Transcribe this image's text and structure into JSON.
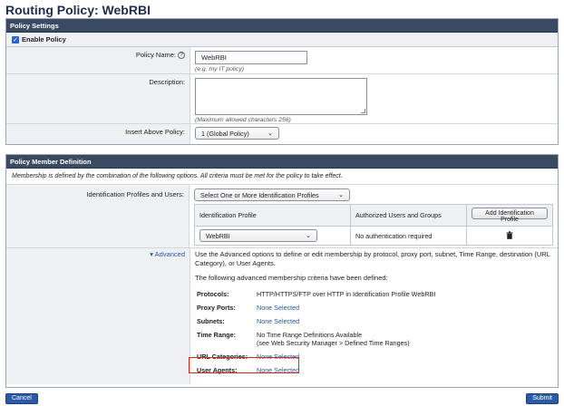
{
  "page": {
    "title": "Routing Policy: WebRBI"
  },
  "policy_settings": {
    "header": "Policy Settings",
    "enable_label": "Enable Policy",
    "name_label": "Policy Name:",
    "name_value": "WebRBI",
    "name_hint": "(e.g. my IT policy)",
    "description_label": "Description:",
    "description_value": "",
    "description_hint": "(Maximum allowed characters 256)",
    "insert_above_label": "Insert Above Policy:",
    "insert_above_value": "1 (Global Policy)"
  },
  "member_definition": {
    "header": "Policy Member Definition",
    "description": "Membership is defined by the combination of the following options. All criteria must be met for the policy to take effect.",
    "id_profiles_label": "Identification Profiles and Users:",
    "id_profiles_select": "Select One or More Identification Profiles",
    "col_profile": "Identification Profile",
    "col_users": "Authorized Users and Groups",
    "add_button": "Add Identification Profile",
    "row_profile": "WebRBI",
    "row_users": "No authentication required",
    "advanced_label": "Advanced",
    "advanced_desc": "Use the Advanced options to define or edit membership by protocol, proxy port, subnet, Time Range, destination (URL Category), or User Agents.",
    "advanced_intro": "The following advanced membership criteria have been defined:",
    "criteria": [
      {
        "key": "Protocols:",
        "value": "HTTP/HTTPS/FTP over HTTP in Identification Profile WebRBI",
        "link": false
      },
      {
        "key": "Proxy Ports:",
        "value": "None Selected",
        "link": true
      },
      {
        "key": "Subnets:",
        "value": "None Selected",
        "link": true
      },
      {
        "key": "Time Range:",
        "value": "No Time Range Definitions Available",
        "value2": "(see Web Security Manager > Defined Time Ranges)",
        "link": false
      },
      {
        "key": "URL Categories:",
        "value": "None Selected",
        "link": true
      },
      {
        "key": "User Agents:",
        "value": "None Selected",
        "link": true
      }
    ]
  },
  "footer": {
    "cancel": "Cancel",
    "submit": "Submit"
  },
  "colors": {
    "header_bg": "#3b4a63",
    "link": "#2657a8",
    "highlight": "#cf2b1b",
    "button_primary": "#2b5aa6"
  }
}
